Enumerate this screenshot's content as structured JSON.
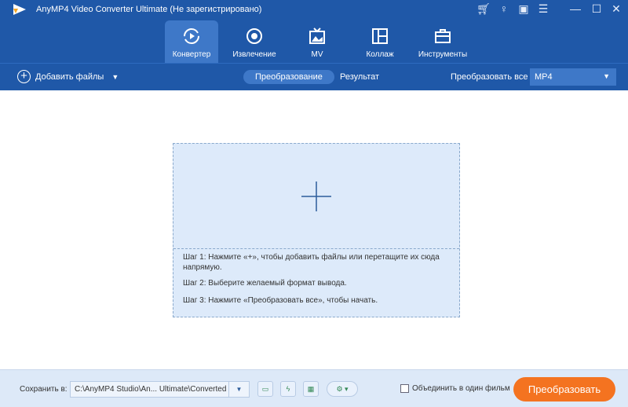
{
  "app": {
    "title": "AnyMP4 Video Converter Ultimate  (Не зарегистрировано)"
  },
  "window_controls": [
    "cart-icon",
    "key-icon",
    "feedback-icon",
    "menu-icon",
    "minimize-icon",
    "maximize-icon",
    "close-icon"
  ],
  "tabs": [
    {
      "label": "Конвертер",
      "active": true
    },
    {
      "label": "Извлечение"
    },
    {
      "label": "MV"
    },
    {
      "label": "Коллаж"
    },
    {
      "label": "Инструменты"
    }
  ],
  "toolbar": {
    "add_files": "Добавить файлы",
    "sub_tabs": [
      "Преобразование",
      "Результат"
    ],
    "convert_all_label": "Преобразовать все в:",
    "format": "MP4"
  },
  "drop": {
    "steps": [
      "Шаг 1: Нажмите «+», чтобы добавить файлы или перетащите их сюда напрямую.",
      "Шаг 2: Выберите желаемый формат вывода.",
      "Шаг 3: Нажмите «Преобразовать все», чтобы начать."
    ]
  },
  "footer": {
    "save_label": "Сохранить в:",
    "path": "C:\\AnyMP4 Studio\\An... Ultimate\\Converted",
    "merge_label": "Объединить в один фильм",
    "convert_button": "Преобразовать",
    "accent": "#f47320"
  }
}
